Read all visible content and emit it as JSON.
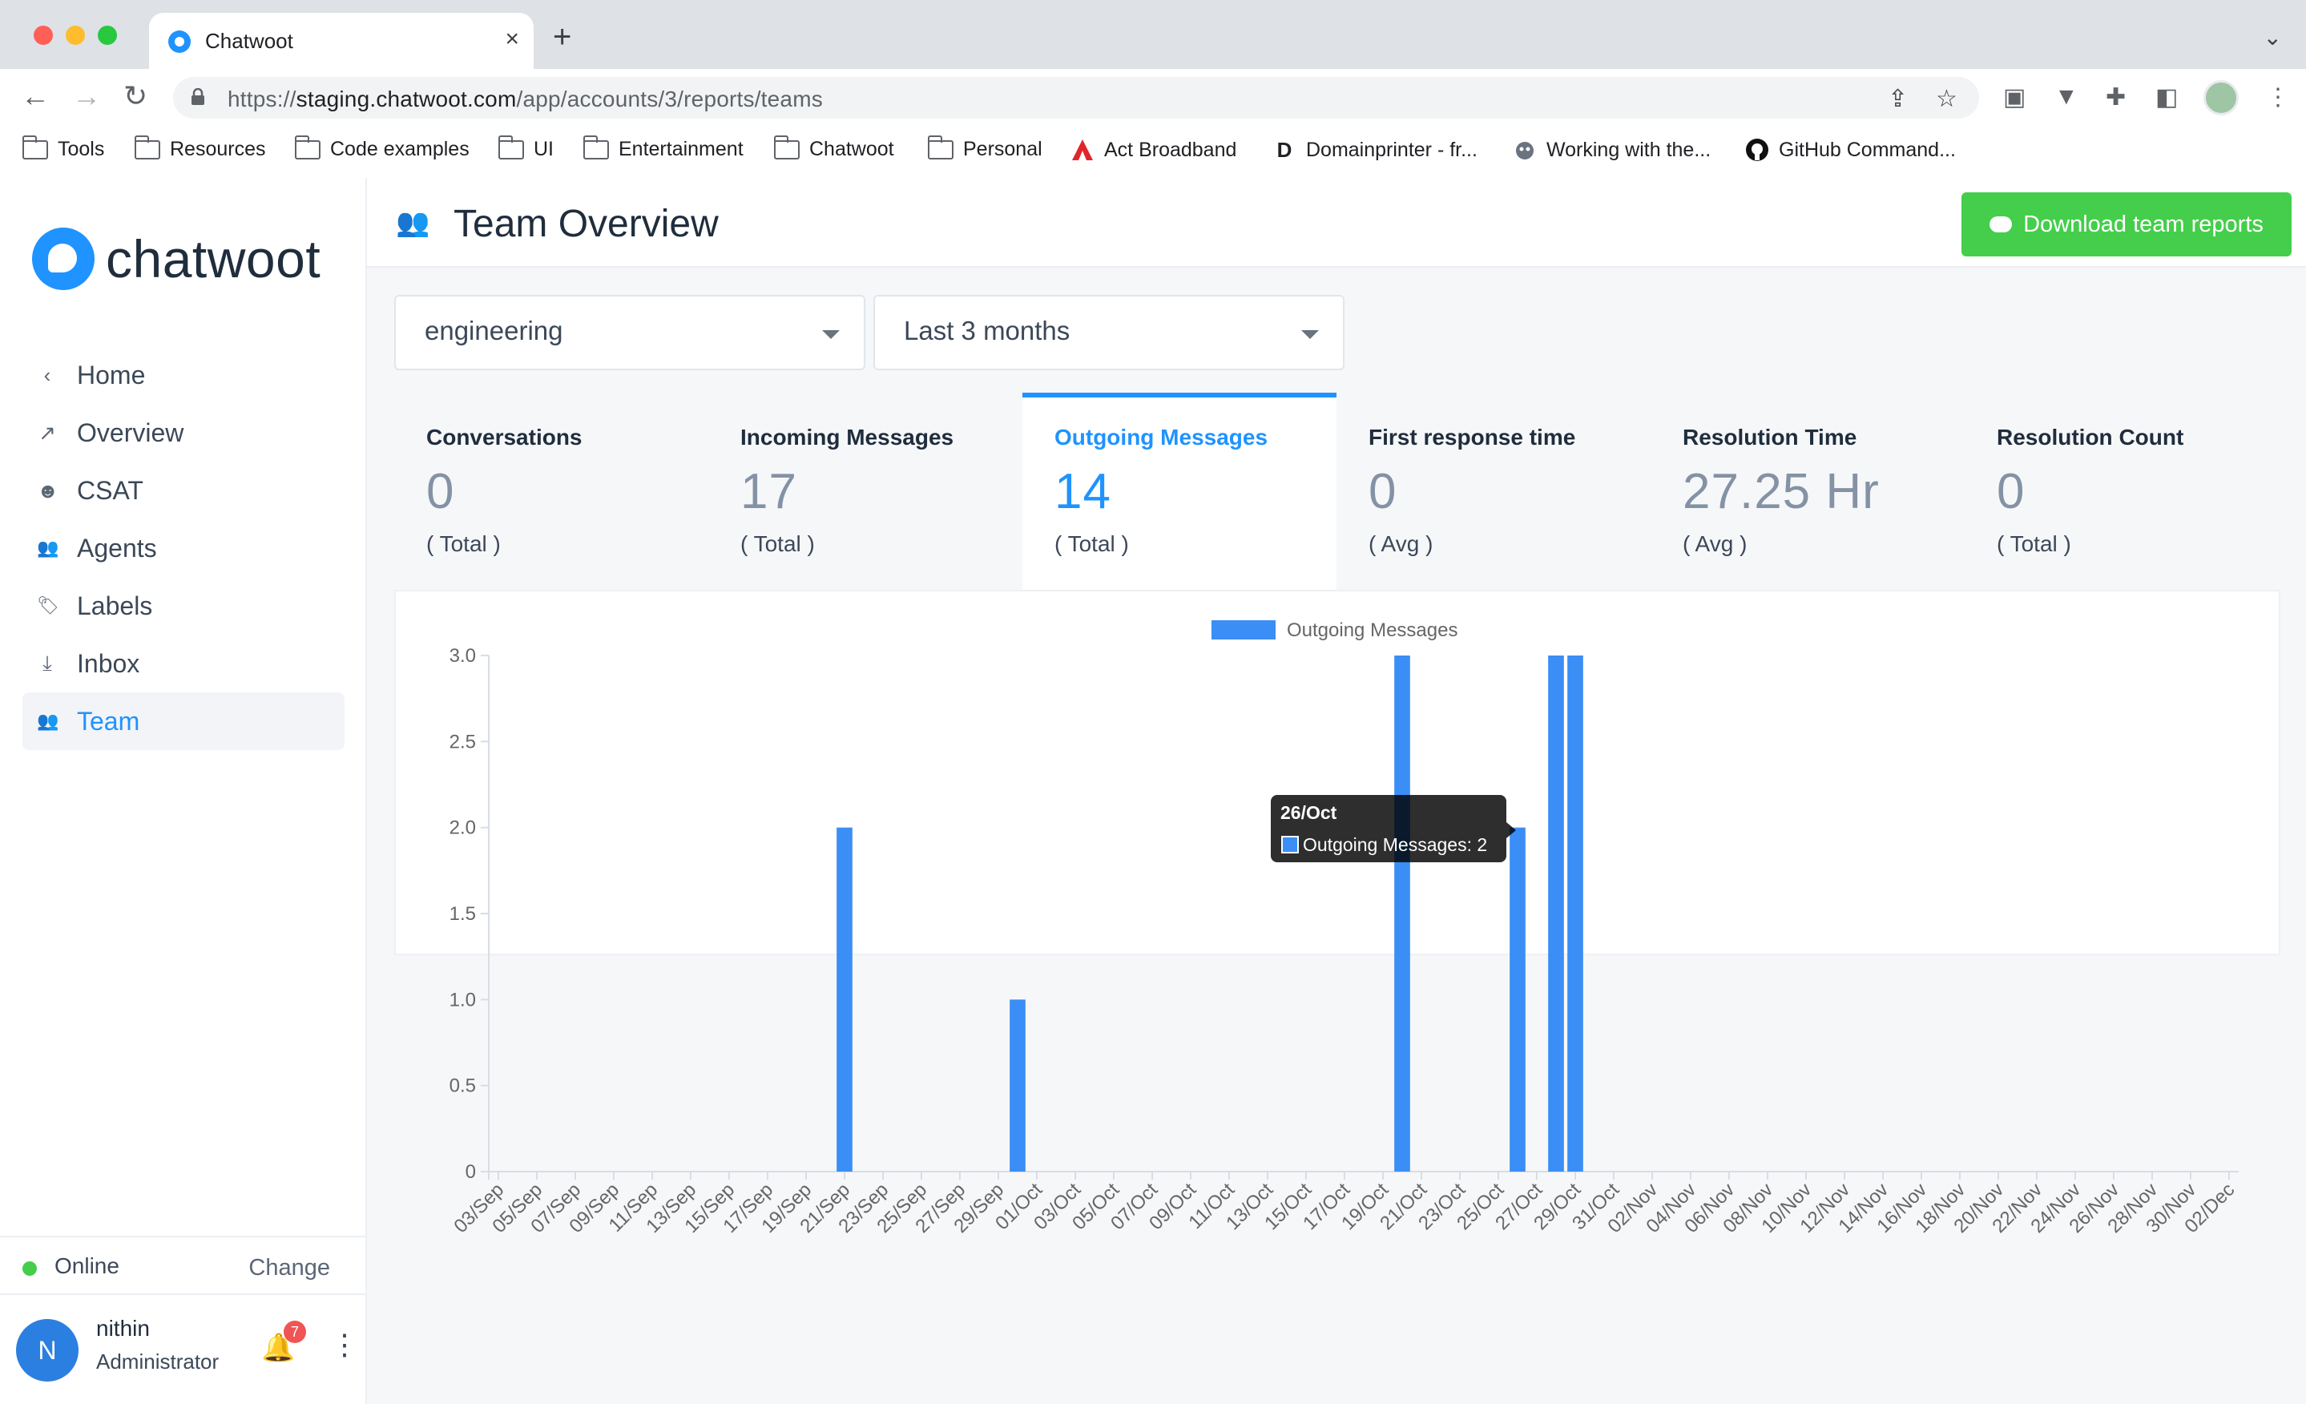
{
  "browser": {
    "tab_title": "Chatwoot",
    "tab_close": "×",
    "new_tab": "+",
    "url_prefix": "https://",
    "url_host": "staging.chatwoot.com",
    "url_path": "/app/accounts/3/reports/teams",
    "bookmarks": [
      "Tools",
      "Resources",
      "Code examples",
      "UI",
      "Entertainment",
      "Chatwoot",
      "Personal",
      "Act Broadband",
      "Domainprinter - fr...",
      "Working with the...",
      "GitHub Command..."
    ]
  },
  "sidebar": {
    "logo_text": "chatwoot",
    "items": [
      {
        "label": "Home",
        "icon": "chevron-left-icon",
        "glyph": "‹"
      },
      {
        "label": "Overview",
        "icon": "trend-icon",
        "glyph": "↗"
      },
      {
        "label": "CSAT",
        "icon": "smiley-icon",
        "glyph": "☻"
      },
      {
        "label": "Agents",
        "icon": "people-icon",
        "glyph": "👥"
      },
      {
        "label": "Labels",
        "icon": "tag-icon",
        "glyph": "🏷"
      },
      {
        "label": "Inbox",
        "icon": "inbox-icon",
        "glyph": "⤓"
      },
      {
        "label": "Team",
        "icon": "team-icon",
        "glyph": "👥"
      }
    ],
    "status": "Online",
    "change": "Change",
    "user_initial": "N",
    "user_name": "nithin",
    "user_role": "Administrator",
    "notification_count": "7"
  },
  "header": {
    "title": "Team Overview",
    "download_label": "Download team reports"
  },
  "filters": {
    "team": "engineering",
    "range": "Last 3 months"
  },
  "metrics": [
    {
      "title": "Conversations",
      "value": "0",
      "sub": "( Total )"
    },
    {
      "title": "Incoming Messages",
      "value": "17",
      "sub": "( Total )"
    },
    {
      "title": "Outgoing Messages",
      "value": "14",
      "sub": "( Total )"
    },
    {
      "title": "First response time",
      "value": "0",
      "sub": "( Avg )"
    },
    {
      "title": "Resolution Time",
      "value": "27.25 Hr",
      "sub": "( Avg )"
    },
    {
      "title": "Resolution Count",
      "value": "0",
      "sub": "( Total )"
    }
  ],
  "colors": {
    "accent": "#1f93ff",
    "bar": "#3b8ef5",
    "success": "#44ce4b"
  },
  "chart_data": {
    "type": "bar",
    "legend": "Outgoing Messages",
    "ylim": [
      0,
      3
    ],
    "yticks": [
      "0",
      "0.5",
      "1.0",
      "1.5",
      "2.0",
      "2.5",
      "3.0"
    ],
    "xtick_labels": [
      "03/Sep",
      "05/Sep",
      "07/Sep",
      "09/Sep",
      "11/Sep",
      "13/Sep",
      "15/Sep",
      "17/Sep",
      "19/Sep",
      "21/Sep",
      "23/Sep",
      "25/Sep",
      "27/Sep",
      "29/Sep",
      "01/Oct",
      "03/Oct",
      "05/Oct",
      "07/Oct",
      "09/Oct",
      "11/Oct",
      "13/Oct",
      "15/Oct",
      "17/Oct",
      "19/Oct",
      "21/Oct",
      "23/Oct",
      "25/Oct",
      "27/Oct",
      "29/Oct",
      "31/Oct",
      "02/Nov",
      "04/Nov",
      "06/Nov",
      "08/Nov",
      "10/Nov",
      "12/Nov",
      "14/Nov",
      "16/Nov",
      "18/Nov",
      "20/Nov",
      "22/Nov",
      "24/Nov",
      "26/Nov",
      "28/Nov",
      "30/Nov",
      "02/Dec"
    ],
    "series": [
      {
        "name": "Outgoing Messages",
        "points": [
          {
            "x": "21/Sep",
            "y": 2
          },
          {
            "x": "30/Sep",
            "y": 1
          },
          {
            "x": "20/Oct",
            "y": 3
          },
          {
            "x": "26/Oct",
            "y": 2
          },
          {
            "x": "28/Oct",
            "y": 3
          },
          {
            "x": "29/Oct",
            "y": 3
          }
        ]
      }
    ],
    "tooltip": {
      "title": "26/Oct",
      "text": "Outgoing Messages: 2"
    }
  }
}
